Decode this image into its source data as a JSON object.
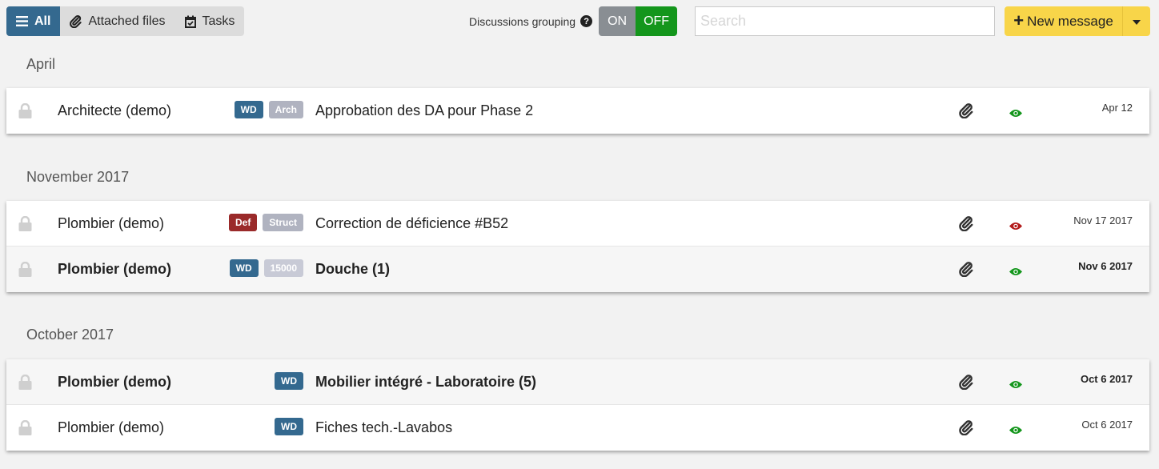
{
  "toolbar": {
    "filters": [
      {
        "label": "All",
        "icon": "menu-icon",
        "active": true
      },
      {
        "label": "Attached files",
        "icon": "paperclip-icon",
        "active": false
      },
      {
        "label": "Tasks",
        "icon": "calendar-check-icon",
        "active": false
      }
    ],
    "grouping": {
      "label": "Discussions grouping",
      "help_icon": "question-circle-icon",
      "on_label": "ON",
      "off_label": "OFF",
      "selected": "OFF"
    },
    "search": {
      "placeholder": "Search",
      "value": ""
    },
    "new_message": {
      "label": "New message",
      "icon": "plus-icon",
      "dropdown_icon": "caret-down-icon"
    }
  },
  "colors": {
    "primary": "#34698f",
    "toggle_on": "#898e93",
    "toggle_off": "#14961c",
    "new_message": "#f8d549",
    "tag_wd": "#34698f",
    "tag_def": "#9a2a2a",
    "tag_gray": "#b0b3c0",
    "tag_light": "#c8cad6",
    "eye_read": "#14961c",
    "eye_unread": "#b31b1b"
  },
  "groups": [
    {
      "title": "April",
      "messages": [
        {
          "sender": "Architecte (demo)",
          "tags": [
            {
              "label": "WD",
              "color": "#34698f"
            },
            {
              "label": "Arch",
              "color": "#b0b3c0"
            }
          ],
          "subject": "Approbation des DA pour Phase 2",
          "attachment": true,
          "eye_status": "seen",
          "eye_color": "#14961c",
          "date": "Apr 12",
          "unread": false
        }
      ]
    },
    {
      "title": "November 2017",
      "messages": [
        {
          "sender": "Plombier (demo)",
          "tags": [
            {
              "label": "Def",
              "color": "#9a2a2a"
            },
            {
              "label": "Struct",
              "color": "#b0b3c0"
            }
          ],
          "subject": "Correction de déficience #B52",
          "attachment": true,
          "eye_status": "not-seen",
          "eye_color": "#b31b1b",
          "date": "Nov 17 2017",
          "unread": false
        },
        {
          "sender": "Plombier (demo)",
          "tags": [
            {
              "label": "WD",
              "color": "#34698f"
            },
            {
              "label": "15000",
              "color": "#c8cad6"
            }
          ],
          "subject": "Douche (1)",
          "attachment": true,
          "eye_status": "seen",
          "eye_color": "#14961c",
          "date": "Nov 6 2017",
          "unread": true
        }
      ]
    },
    {
      "title": "October 2017",
      "messages": [
        {
          "sender": "Plombier (demo)",
          "tags": [
            {
              "label": "WD",
              "color": "#34698f"
            }
          ],
          "subject": "Mobilier intégré - Laboratoire (5)",
          "attachment": true,
          "eye_status": "seen",
          "eye_color": "#14961c",
          "date": "Oct 6 2017",
          "unread": true
        },
        {
          "sender": "Plombier (demo)",
          "tags": [
            {
              "label": "WD",
              "color": "#34698f"
            }
          ],
          "subject": "Fiches tech.-Lavabos",
          "attachment": true,
          "eye_status": "seen",
          "eye_color": "#14961c",
          "date": "Oct 6 2017",
          "unread": false
        }
      ]
    }
  ]
}
